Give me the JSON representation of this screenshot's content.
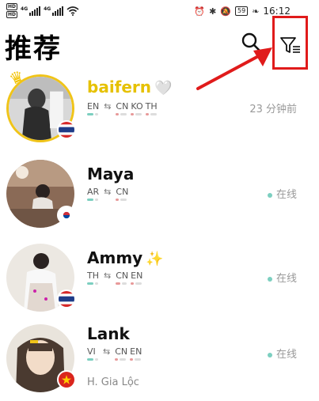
{
  "status_bar": {
    "hd1": "HD",
    "hd2": "HD",
    "net1": "4G",
    "net2": "4G",
    "battery": "59",
    "time": "16:12"
  },
  "header": {
    "title": "推荐"
  },
  "users": [
    {
      "name": "baifern",
      "badge": "🤍",
      "native": "EN",
      "learning": [
        "CN",
        "KO",
        "TH"
      ],
      "status": "23 分钟前",
      "online": false,
      "location": "",
      "flag": "thailand"
    },
    {
      "name": "Maya",
      "badge": "",
      "native": "AR",
      "learning": [
        "CN"
      ],
      "status": "在线",
      "online": true,
      "location": "",
      "flag": "korea"
    },
    {
      "name": "Ammy",
      "badge": "✨",
      "native": "TH",
      "learning": [
        "CN",
        "EN"
      ],
      "status": "在线",
      "online": true,
      "location": "",
      "flag": "thailand"
    },
    {
      "name": "Lank",
      "badge": "",
      "native": "VI",
      "learning": [
        "CN",
        "EN"
      ],
      "status": "在线",
      "online": true,
      "location": "H. Gia Lộc",
      "flag": "vietnam"
    }
  ],
  "colors": {
    "accent_red": "#e01b1b",
    "online_dot": "#7ccfc0",
    "gold": "#f0c419"
  },
  "icons": {
    "search": "search-icon",
    "filter": "filter-icon",
    "crown": "crown-icon",
    "swap": "swap-arrows-icon"
  }
}
